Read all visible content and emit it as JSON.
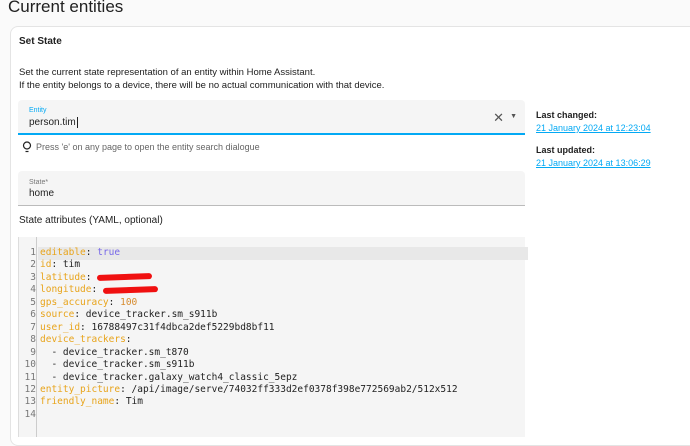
{
  "page_title": "Current entities",
  "card": {
    "title": "Set State",
    "desc1": "Set the current state representation of an entity within Home Assistant.",
    "desc2": "If the entity belongs to a device, there will be no actual communication with that device.",
    "entity": {
      "label": "Entity",
      "value": "person.tim"
    },
    "hint": "Press 'e' on any page to open the entity search dialogue",
    "state": {
      "label": "State*",
      "value": "home"
    },
    "last_changed_label": "Last changed:",
    "last_changed": "21 January 2024 at 12:23:04",
    "last_updated_label": "Last updated:",
    "last_updated": "21 January 2024 at 13:06:29",
    "attr_label": "State attributes (YAML, optional)"
  },
  "yaml": [
    {
      "k": "editable",
      "v": "true",
      "t": "b"
    },
    {
      "k": "id",
      "v": "tim"
    },
    {
      "k": "latitude",
      "v": "",
      "redacted": true
    },
    {
      "k": "longitude",
      "v": "",
      "redacted": true
    },
    {
      "k": "gps_accuracy",
      "v": "100",
      "t": "n"
    },
    {
      "k": "source",
      "v": "device_tracker.sm_s911b"
    },
    {
      "k": "user_id",
      "v": "16788497c31f4dbca2def5229bd8bf11"
    },
    {
      "k": "device_trackers",
      "v": ""
    },
    {
      "item": "device_tracker.sm_t870"
    },
    {
      "item": "device_tracker.sm_s911b"
    },
    {
      "item": "device_tracker.galaxy_watch4_classic_5epz"
    },
    {
      "k": "entity_picture",
      "v": "/api/image/serve/74032ff333d2ef0378f398e772569ab2/512x512"
    },
    {
      "k": "friendly_name",
      "v": "Tim"
    },
    {
      "empty": true
    }
  ]
}
